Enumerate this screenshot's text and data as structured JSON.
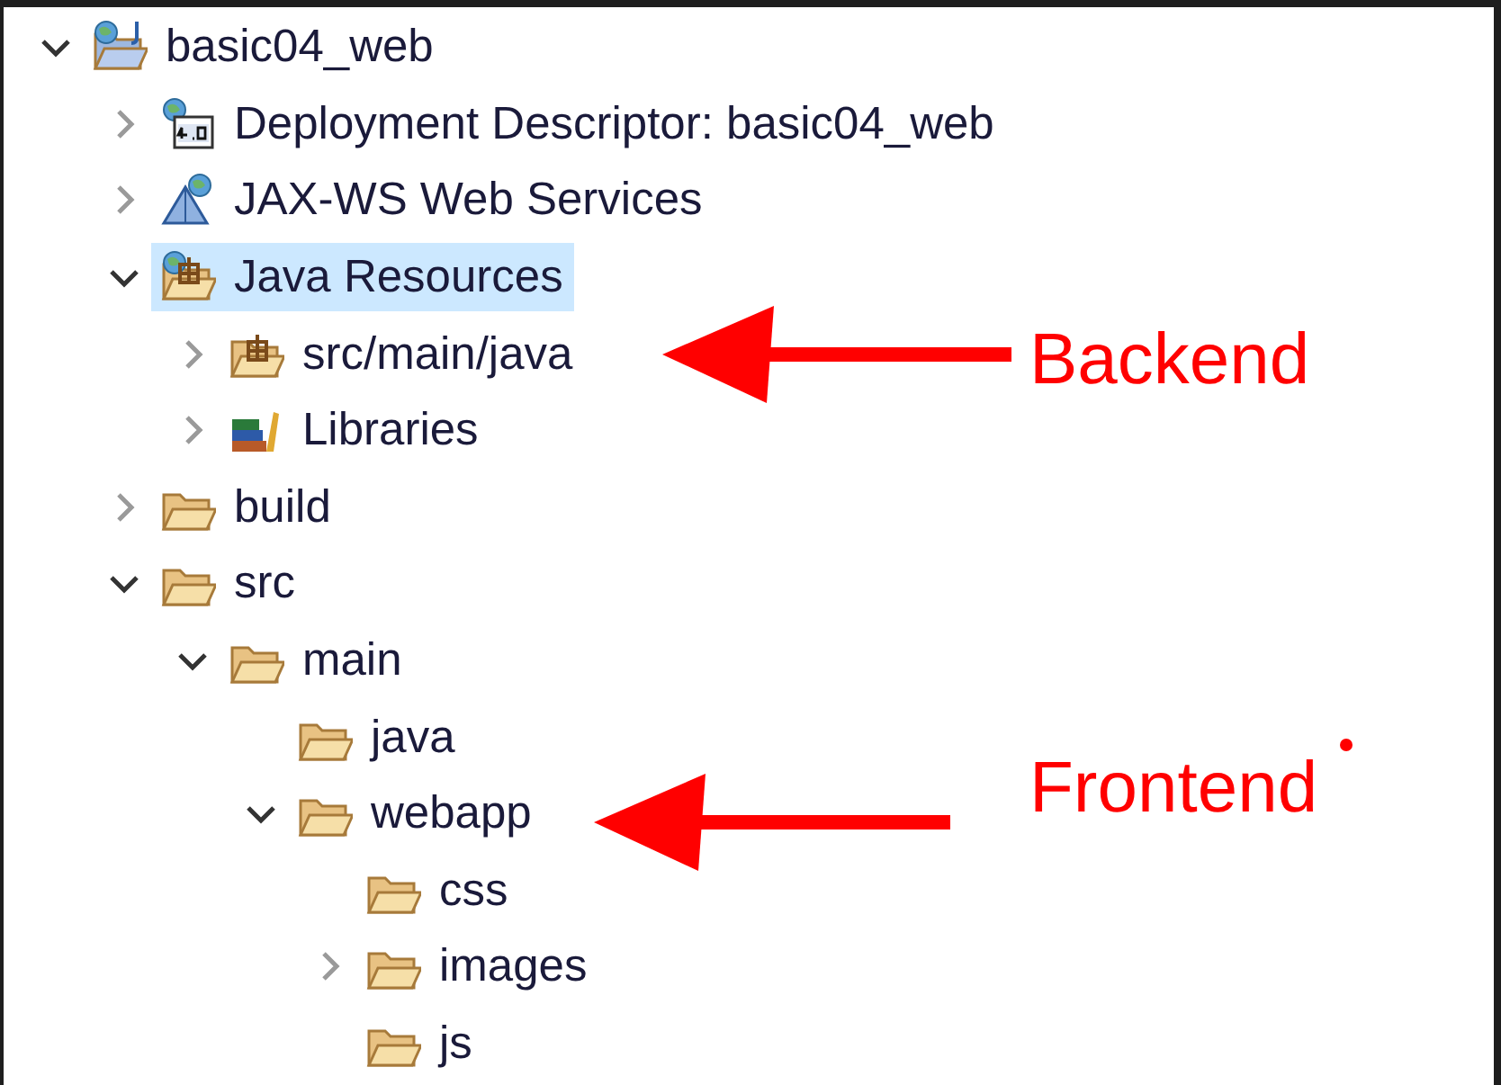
{
  "tree": [
    {
      "label": "basic04_web",
      "kind": "project",
      "expandable": true,
      "expanded": true,
      "selected": false,
      "children": [
        {
          "label": "Deployment Descriptor: basic04_web",
          "kind": "descriptor",
          "expandable": true,
          "expanded": false,
          "selected": false
        },
        {
          "label": "JAX-WS Web Services",
          "kind": "webservices",
          "expandable": true,
          "expanded": false,
          "selected": false
        },
        {
          "label": "Java Resources",
          "kind": "resources",
          "expandable": true,
          "expanded": true,
          "selected": true,
          "children": [
            {
              "label": "src/main/java",
              "kind": "package-root",
              "expandable": true,
              "expanded": false,
              "selected": false
            },
            {
              "label": "Libraries",
              "kind": "libraries",
              "expandable": true,
              "expanded": false,
              "selected": false
            }
          ]
        },
        {
          "label": "build",
          "kind": "folder",
          "expandable": true,
          "expanded": false,
          "selected": false
        },
        {
          "label": "src",
          "kind": "folder",
          "expandable": true,
          "expanded": true,
          "selected": false,
          "children": [
            {
              "label": "main",
              "kind": "folder",
              "expandable": true,
              "expanded": true,
              "selected": false,
              "children": [
                {
                  "label": "java",
                  "kind": "folder",
                  "expandable": false,
                  "selected": false
                },
                {
                  "label": "webapp",
                  "kind": "folder",
                  "expandable": true,
                  "expanded": true,
                  "selected": false,
                  "children": [
                    {
                      "label": "css",
                      "kind": "folder",
                      "expandable": false,
                      "selected": false
                    },
                    {
                      "label": "images",
                      "kind": "folder",
                      "expandable": true,
                      "expanded": false,
                      "selected": false
                    },
                    {
                      "label": "js",
                      "kind": "folder",
                      "expandable": false,
                      "selected": false
                    }
                  ]
                }
              ]
            }
          ]
        }
      ]
    }
  ],
  "annotations": [
    {
      "label": "Backend"
    },
    {
      "label": "Frontend"
    }
  ]
}
